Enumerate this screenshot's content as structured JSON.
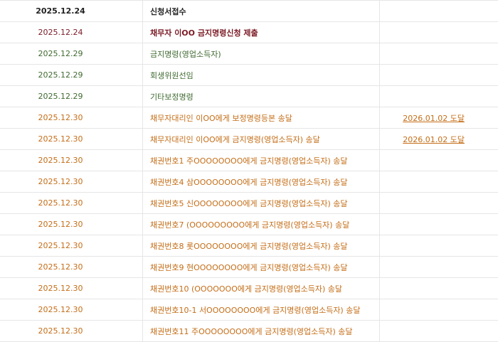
{
  "rows": [
    {
      "date": "2025.12.24",
      "event": "신청서접수",
      "result": "",
      "style": "black"
    },
    {
      "date": "2025.12.24",
      "event": "채무자 이OO 금지명령신청 제출",
      "result": "",
      "style": "maroon"
    },
    {
      "date": "2025.12.29",
      "event": "금지명령(영업소득자)",
      "result": "",
      "style": "green"
    },
    {
      "date": "2025.12.29",
      "event": "회생위원선임",
      "result": "",
      "style": "green"
    },
    {
      "date": "2025.12.29",
      "event": "기타보정명령",
      "result": "",
      "style": "green"
    },
    {
      "date": "2025.12.30",
      "event": "채무자대리인 이OO에게 보정명령등본 송달",
      "result": "2026.01.02 도달",
      "style": "orange"
    },
    {
      "date": "2025.12.30",
      "event": "채무자대리인 이OO에게 금지명령(영업소득자) 송달",
      "result": "2026.01.02 도달",
      "style": "orange"
    },
    {
      "date": "2025.12.30",
      "event": "채권번호1 주OOOOOOOO에게 금지명령(영업소득자) 송달",
      "result": "",
      "style": "orange"
    },
    {
      "date": "2025.12.30",
      "event": "채권번호4 삼OOOOOOOO에게 금지명령(영업소득자) 송달",
      "result": "",
      "style": "orange"
    },
    {
      "date": "2025.12.30",
      "event": "채권번호5 신OOOOOOOO에게 금지명령(영업소득자) 송달",
      "result": "",
      "style": "orange"
    },
    {
      "date": "2025.12.30",
      "event": "채권번호7 (OOOOOOOOO에게 금지명령(영업소득자) 송달",
      "result": "",
      "style": "orange"
    },
    {
      "date": "2025.12.30",
      "event": "채권번호8 롯OOOOOOOO에게 금지명령(영업소득자) 송달",
      "result": "",
      "style": "orange"
    },
    {
      "date": "2025.12.30",
      "event": "채권번호9 현OOOOOOOO에게 금지명령(영업소득자) 송달",
      "result": "",
      "style": "orange"
    },
    {
      "date": "2025.12.30",
      "event": "채권번호10 (OOOOOOO에게 금지명령(영업소득자) 송달",
      "result": "",
      "style": "orange"
    },
    {
      "date": "2025.12.30",
      "event": "채권번호10-1 서OOOOOOOO에게 금지명령(영업소득자) 송달",
      "result": "",
      "style": "orange"
    },
    {
      "date": "2025.12.30",
      "event": "채권번호11 주OOOOOOOO에게 금지명령(영업소득자) 송달",
      "result": "",
      "style": "orange"
    }
  ],
  "colors": {
    "black": "#222222",
    "maroon": "#7a1a24",
    "green": "#3f6a30",
    "orange": "#c46d17",
    "border": "#e6e6e6"
  }
}
